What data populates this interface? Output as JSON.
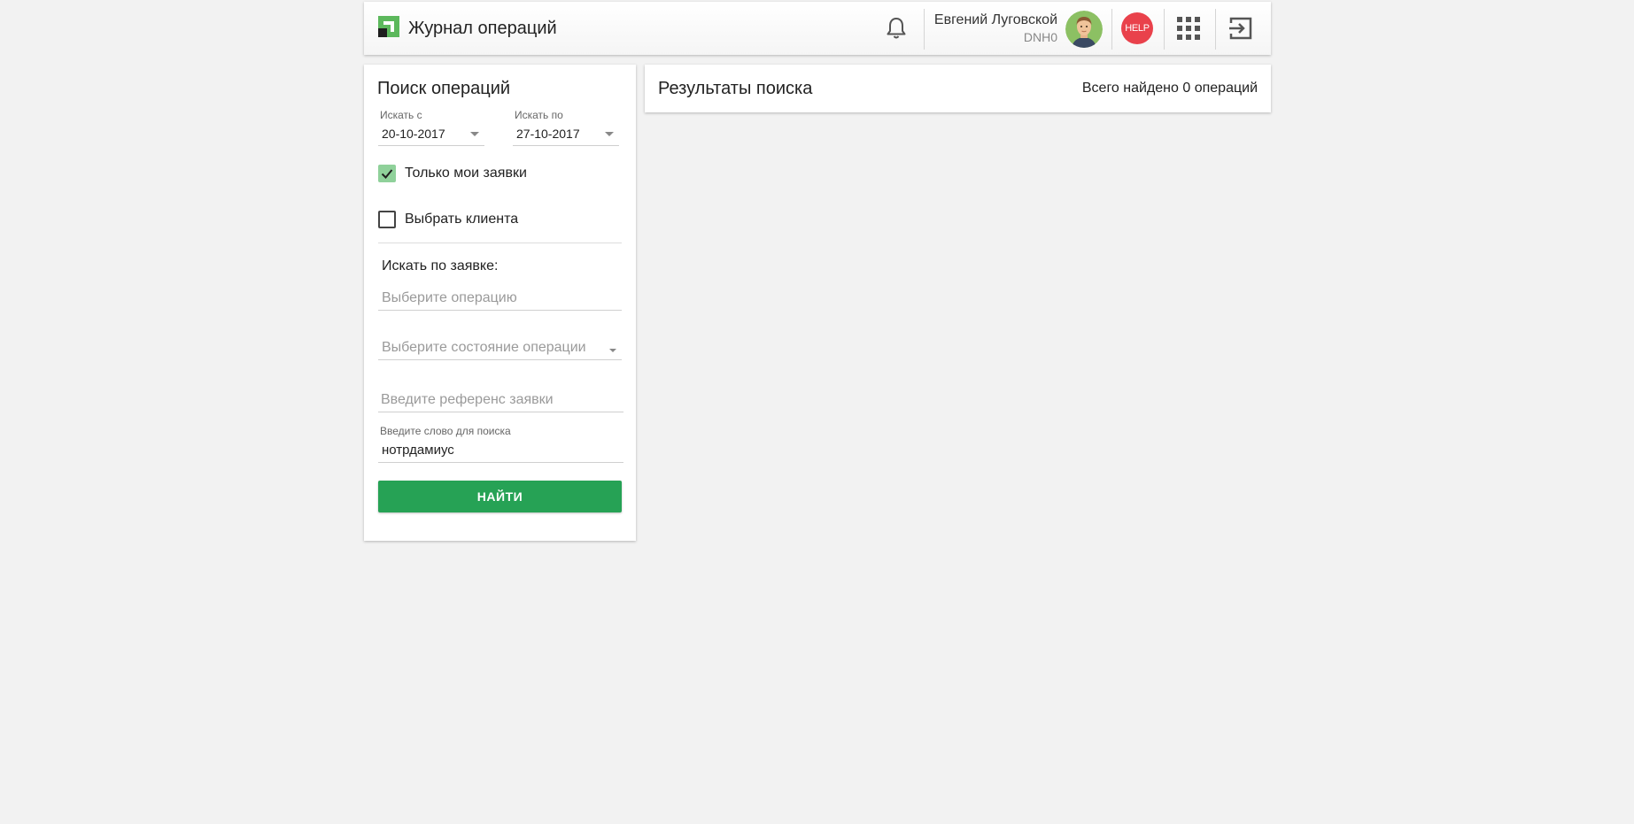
{
  "header": {
    "title": "Журнал операций",
    "user_name": "Евгений Луговской",
    "user_code": "DNH0",
    "help_label": "HELP",
    "icons": {
      "logo": "privatbank-logo-icon",
      "notifications": "bell-icon",
      "apps": "apps-grid-icon",
      "logout": "logout-icon"
    }
  },
  "search": {
    "title": "Поиск операций",
    "date_from": {
      "label": "Искать с",
      "value": "20-10-2017"
    },
    "date_to": {
      "label": "Искать по",
      "value": "27-10-2017"
    },
    "only_mine": {
      "label": "Только мои заявки",
      "checked": true
    },
    "choose_client": {
      "label": "Выбрать клиента",
      "checked": false
    },
    "by_request_label": "Искать по заявке:",
    "operation": {
      "placeholder": "Выберите операцию"
    },
    "operation_state": {
      "placeholder": "Выберите состояние операции"
    },
    "reference": {
      "placeholder": "Введите референс заявки"
    },
    "keyword": {
      "label": "Введите слово для поиска",
      "value": "нотрдамиус"
    },
    "find_button": "НАЙТИ"
  },
  "results": {
    "title": "Результаты поиска",
    "count_text": "Всего найдено 0 операций"
  },
  "colors": {
    "background": "#f2f2f2",
    "brand_green": "#26a255",
    "checkbox_checked": "#8fd19a",
    "help_red": "#e9414b"
  }
}
